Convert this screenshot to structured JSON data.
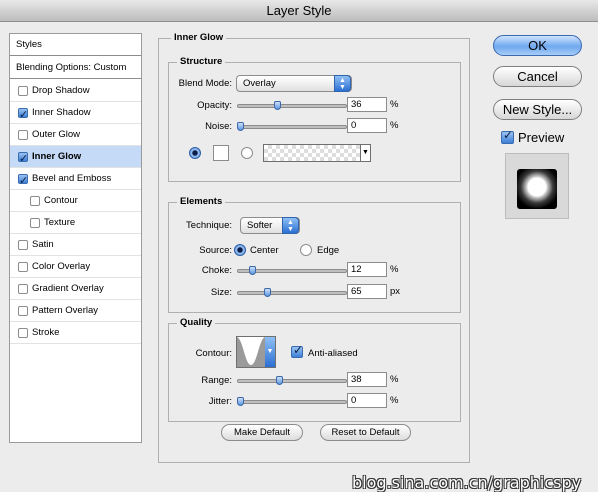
{
  "window": {
    "title": "Layer Style"
  },
  "styles_list": {
    "header": "Styles",
    "blending_options": "Blending Options: Custom",
    "items": [
      {
        "label": "Drop Shadow",
        "checked": false,
        "indent": false,
        "selected": false
      },
      {
        "label": "Inner Shadow",
        "checked": true,
        "indent": false,
        "selected": false
      },
      {
        "label": "Outer Glow",
        "checked": false,
        "indent": false,
        "selected": false
      },
      {
        "label": "Inner Glow",
        "checked": true,
        "indent": false,
        "selected": true
      },
      {
        "label": "Bevel and Emboss",
        "checked": true,
        "indent": false,
        "selected": false
      },
      {
        "label": "Contour",
        "checked": false,
        "indent": true,
        "selected": false
      },
      {
        "label": "Texture",
        "checked": false,
        "indent": true,
        "selected": false
      },
      {
        "label": "Satin",
        "checked": false,
        "indent": false,
        "selected": false
      },
      {
        "label": "Color Overlay",
        "checked": false,
        "indent": false,
        "selected": false
      },
      {
        "label": "Gradient Overlay",
        "checked": false,
        "indent": false,
        "selected": false
      },
      {
        "label": "Pattern Overlay",
        "checked": false,
        "indent": false,
        "selected": false
      },
      {
        "label": "Stroke",
        "checked": false,
        "indent": false,
        "selected": false
      }
    ]
  },
  "inner_glow": {
    "title": "Inner Glow",
    "structure": {
      "title": "Structure",
      "blend_mode_label": "Blend Mode:",
      "blend_mode_value": "Overlay",
      "opacity_label": "Opacity:",
      "opacity_value": "36",
      "opacity_unit": "%",
      "noise_label": "Noise:",
      "noise_value": "0",
      "noise_unit": "%"
    },
    "elements": {
      "title": "Elements",
      "technique_label": "Technique:",
      "technique_value": "Softer",
      "source_label": "Source:",
      "source_center": "Center",
      "source_edge": "Edge",
      "choke_label": "Choke:",
      "choke_value": "12",
      "choke_unit": "%",
      "size_label": "Size:",
      "size_value": "65",
      "size_unit": "px"
    },
    "quality": {
      "title": "Quality",
      "contour_label": "Contour:",
      "anti_aliased_label": "Anti-aliased",
      "range_label": "Range:",
      "range_value": "38",
      "range_unit": "%",
      "jitter_label": "Jitter:",
      "jitter_value": "0",
      "jitter_unit": "%"
    },
    "make_default": "Make Default",
    "reset_default": "Reset to Default"
  },
  "buttons": {
    "ok": "OK",
    "cancel": "Cancel",
    "new_style": "New Style...",
    "preview": "Preview"
  },
  "watermark": "blog.sina.com.cn/graphicspy",
  "colors": {
    "accent": "#3d7fd6",
    "selection": "#c4daf7"
  }
}
